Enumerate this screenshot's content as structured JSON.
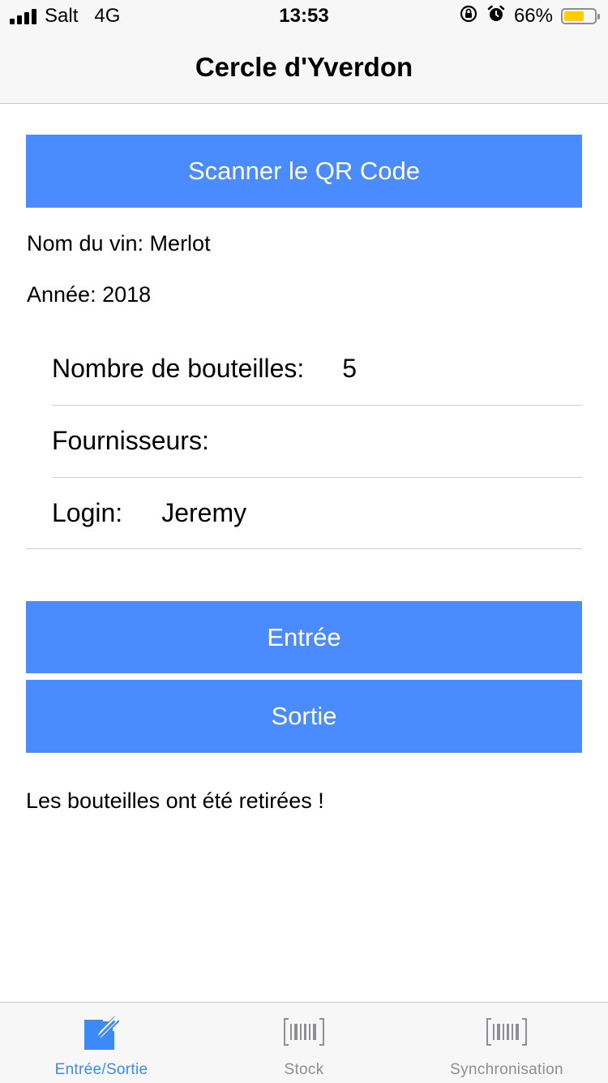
{
  "status_bar": {
    "carrier": "Salt",
    "network": "4G",
    "time": "13:53",
    "battery_percent_text": "66%",
    "battery_level": 0.66,
    "battery_color": "#ffcc00",
    "icons": [
      "signal-icon",
      "rotation-lock-icon",
      "alarm-icon",
      "battery-icon"
    ]
  },
  "nav": {
    "title": "Cercle d'Yverdon"
  },
  "scan_button": {
    "label": "Scanner le QR Code"
  },
  "wine": {
    "name_line": "Nom du vin: Merlot",
    "year_line": "Année: 2018"
  },
  "form": {
    "bottles_label": "Nombre de bouteilles:",
    "bottles_value": "5",
    "suppliers_label": "Fournisseurs:",
    "suppliers_value": "",
    "login_label": "Login:",
    "login_value": "Jeremy"
  },
  "actions": {
    "entree_label": "Entrée",
    "sortie_label": "Sortie"
  },
  "message": "Les bouteilles ont été retirées !",
  "tabbar": {
    "tabs": [
      {
        "label": "Entrée/Sortie",
        "icon": "edit-icon",
        "active": true
      },
      {
        "label": "Stock",
        "icon": "barcode-icon",
        "active": false
      },
      {
        "label": "Synchronisation",
        "icon": "barcode-icon",
        "active": false
      }
    ]
  },
  "colors": {
    "accent": "#4a8cff",
    "tab_active": "#3b8af7",
    "tab_inactive": "#8e8e93"
  }
}
